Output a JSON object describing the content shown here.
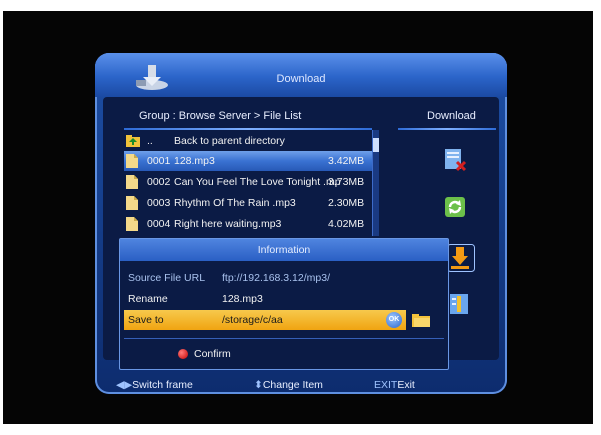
{
  "window": {
    "title": "Download"
  },
  "file_list": {
    "breadcrumb": "Group : Browse Server > File List",
    "parent_num": "..",
    "parent_label": "Back to parent directory",
    "rows": [
      {
        "num": "0001",
        "name": "128.mp3",
        "size": "3.42MB"
      },
      {
        "num": "0002",
        "name": "Can You Feel The Love Tonight .mp",
        "size": "3.73MB"
      },
      {
        "num": "0003",
        "name": "Rhythm Of The Rain .mp3",
        "size": "2.30MB"
      },
      {
        "num": "0004",
        "name": "Right here waiting.mp3",
        "size": "4.02MB"
      }
    ]
  },
  "right_panel": {
    "title": "Download",
    "buttons": [
      "search-icon",
      "refresh-icon",
      "download-icon",
      "info-icon"
    ]
  },
  "info_dialog": {
    "title": "Information",
    "source_label": "Source File URL",
    "source_value": "ftp://192.168.3.12/mp3/",
    "rename_label": "Rename",
    "rename_value": "128.mp3",
    "save_label": "Save to",
    "save_value": "/storage/c/aa",
    "ok_badge": "OK",
    "confirm_label": "Confirm"
  },
  "footer": {
    "switch": "Switch frame",
    "change": "Change Item",
    "exit_key": "EXIT",
    "exit_label": "Exit"
  },
  "colors": {
    "window_blue": "#1d4fa6",
    "selection_blue": "#3a72d2",
    "highlight_orange": "#f0a411",
    "confirm_red": "#c40000"
  }
}
